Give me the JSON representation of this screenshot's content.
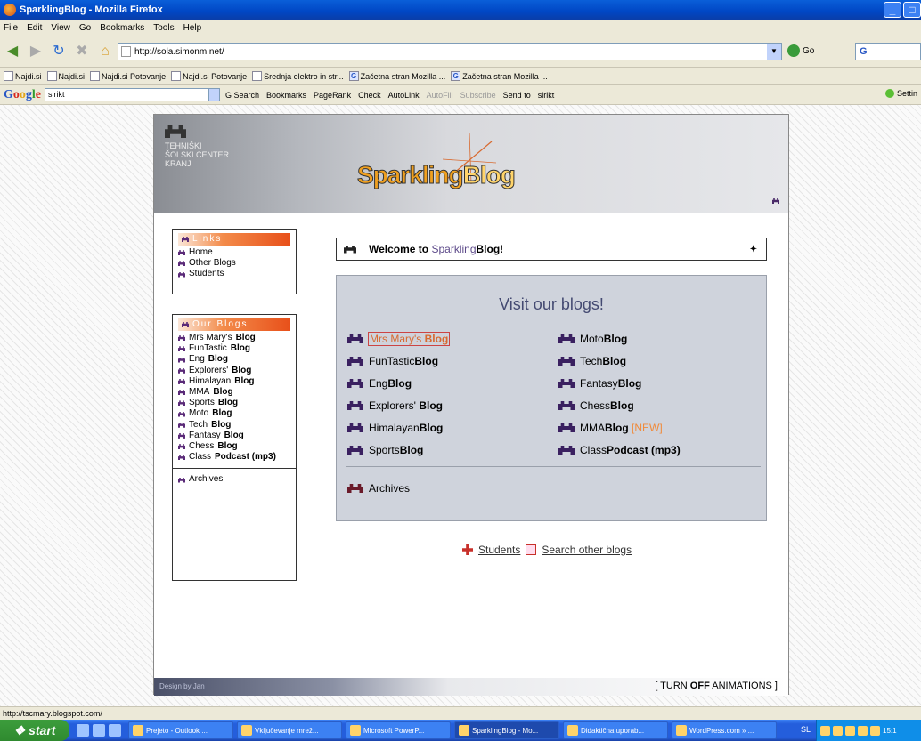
{
  "window": {
    "title": "SparklingBlog - Mozilla Firefox",
    "min": "_",
    "max": "□"
  },
  "menu": [
    "File",
    "Edit",
    "View",
    "Go",
    "Bookmarks",
    "Tools",
    "Help"
  ],
  "nav": {
    "url": "http://sola.simonm.net/",
    "go_label": "Go",
    "search_engine": "G"
  },
  "bookmarks": [
    {
      "label": "Najdi.si",
      "icon": "najdi-icon"
    },
    {
      "label": "Najdi.si",
      "icon": "najdi-icon"
    },
    {
      "label": "Najdi.si Potovanje",
      "icon": "page-icon"
    },
    {
      "label": "Najdi.si Potovanje",
      "icon": "page-icon"
    },
    {
      "label": "Srednja elektro in str...",
      "icon": "page-icon"
    },
    {
      "label": "Začetna stran Mozilla ...",
      "icon": "google-icon"
    },
    {
      "label": "Začetna stran Mozilla ...",
      "icon": "google-icon"
    }
  ],
  "google_bar": {
    "logo": "Google",
    "query": "sirikt",
    "tools": [
      "G Search",
      "Bookmarks",
      "PageRank",
      "Check",
      "AutoLink",
      "AutoFill",
      "Subscribe",
      "Send to",
      "sirikt"
    ],
    "settings": "Settin"
  },
  "site": {
    "school_lines": [
      "TEHNIŠKI",
      "ŠOLSKI CENTER",
      "KRANJ"
    ],
    "logo_part1": "Sparkling",
    "logo_part2": "Blog",
    "links_head": "Links",
    "links": [
      "Home",
      "Other Blogs",
      "Students"
    ],
    "blogs_head": "Our Blogs",
    "sidebar_blogs": [
      {
        "pre": "Mrs Mary's ",
        "bold": "Blog"
      },
      {
        "pre": "FunTastic",
        "bold": "Blog"
      },
      {
        "pre": "Eng",
        "bold": "Blog"
      },
      {
        "pre": "Explorers' ",
        "bold": "Blog"
      },
      {
        "pre": "Himalayan",
        "bold": "Blog"
      },
      {
        "pre": "MMA",
        "bold": "Blog"
      },
      {
        "pre": "Sports",
        "bold": "Blog"
      },
      {
        "pre": "Moto",
        "bold": "Blog"
      },
      {
        "pre": "Tech",
        "bold": "Blog"
      },
      {
        "pre": "Fantasy",
        "bold": "Blog"
      },
      {
        "pre": "Chess",
        "bold": "Blog"
      },
      {
        "pre": "Class",
        "bold": "Podcast (mp3)"
      }
    ],
    "sidebar_archives": "Archives",
    "welcome_pre": "Welcome to ",
    "welcome_hl": "Sparkling",
    "welcome_post": "Blog!",
    "visit_title": "Visit our blogs!",
    "left_blogs": [
      {
        "pre": "Mrs Mary's ",
        "bold": "Blog"
      },
      {
        "pre": "FunTastic",
        "bold": "Blog"
      },
      {
        "pre": "Eng",
        "bold": "Blog"
      },
      {
        "pre": "Explorers' ",
        "bold": "Blog"
      },
      {
        "pre": "Himalayan",
        "bold": "Blog"
      },
      {
        "pre": "Sports",
        "bold": "Blog"
      }
    ],
    "right_blogs": [
      {
        "pre": "Moto",
        "bold": "Blog"
      },
      {
        "pre": "Tech",
        "bold": "Blog"
      },
      {
        "pre": "Fantasy",
        "bold": "Blog"
      },
      {
        "pre": "Chess",
        "bold": "Blog"
      },
      {
        "pre": "MMA",
        "bold": "Blog",
        "extra": " [NEW]"
      },
      {
        "pre": "Class",
        "bold": "Podcast (mp3)"
      }
    ],
    "archives": "Archives",
    "students_link": "Students",
    "search_link": "Search other blogs",
    "design_by": "Design by Jan",
    "anim_pre": "[ TURN ",
    "anim_bold": "OFF",
    "anim_post": " ANIMATIONS ]"
  },
  "status": "http://tscmary.blogspot.com/",
  "taskbar": {
    "start": "start",
    "tasks": [
      "Prejeto - Outlook ...",
      "Vključevanje mrež...",
      "Microsoft PowerP...",
      "SparklingBlog - Mo...",
      "Didaktična uporab...",
      "WordPress.com » ..."
    ],
    "lang": "SL",
    "clock": "15:1"
  }
}
